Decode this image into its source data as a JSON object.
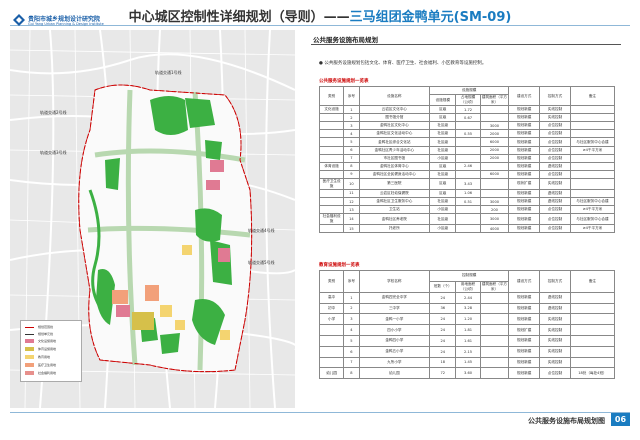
{
  "header": {
    "title_prefix": "中心城区控制性详细规划（导则）——",
    "title_accent": "三马组团金鸭单元(SM-09)"
  },
  "map": {
    "labels": {
      "rail1": "轨道交通1号线",
      "rail2": "轨道交通2号线",
      "rail3": "轨道交通3号线",
      "rail4": "轨道交通4号线",
      "rail5": "轨道交通5号线"
    },
    "legend": {
      "items": [
        {
          "label": "规划范围线",
          "color": "#cc0000"
        },
        {
          "label": "规划单元线",
          "color": "#333333"
        },
        {
          "label": "文化设施用地",
          "color": "#e07a93"
        },
        {
          "label": "体育设施用地",
          "color": "#d6c04a"
        },
        {
          "label": "教育用地",
          "color": "#f4d470"
        },
        {
          "label": "医疗卫生用地",
          "color": "#f2a07a"
        },
        {
          "label": "社会福利用地",
          "color": "#e7908c"
        }
      ]
    }
  },
  "right": {
    "section_title": "公共服务设施布局规划",
    "bullet": "● 公共服务设施规划包括文化、体育、医疗卫生、社会福利、小区教育等设施控制。",
    "table1_title": "公共服务设施规划一览表",
    "table1_headers": [
      "类别",
      "序号",
      "设施名称",
      "设施规模",
      "占地规模（公顷）",
      "建筑面积（平方米）",
      "建设方式",
      "控制方式",
      "备注"
    ],
    "table1_group_header": "设施规模",
    "table1_rows": [
      [
        "文化设施",
        "1",
        "云岩区文化中心",
        "区级",
        "1.72",
        "",
        "规划新建",
        "实线控制",
        ""
      ],
      [
        "",
        "2",
        "图书馆分馆",
        "区级",
        "0.67",
        "",
        "规划新建",
        "实线控制",
        ""
      ],
      [
        "",
        "3",
        "金鸭社区文化中心",
        "社区级",
        "",
        "3000",
        "规划新建",
        "点位控制",
        ""
      ],
      [
        "",
        "4",
        "金鸭社区文化活动中心",
        "社区级",
        "0.55",
        "2000",
        "规划新建",
        "点位控制",
        ""
      ],
      [
        "",
        "5",
        "金鸭社区综合文化站",
        "社区级",
        "",
        "6000",
        "规划新建",
        "点位控制",
        "与社区服务中心合建"
      ],
      [
        "",
        "6",
        "金鸭社区青少年活动中心",
        "社区级",
        "",
        "2000",
        "规划新建",
        "点位控制",
        "≥4千平方米"
      ],
      [
        "",
        "7",
        "市社区图书馆",
        "小区级",
        "",
        "2000",
        "规划新建",
        "点位控制",
        ""
      ],
      [
        "体育设施",
        "8",
        "金鸭社区体育中心",
        "区级",
        "2.46",
        "",
        "规划新建",
        "虚线控制",
        ""
      ],
      [
        "",
        "9",
        "金鸭社区全民健身活动中心",
        "社区级",
        "",
        "6000",
        "规划新建",
        "点位控制",
        ""
      ],
      [
        "医疗卫生设施",
        "10",
        "第三医院",
        "区级",
        "3.43",
        "",
        "现状扩建",
        "实线控制",
        ""
      ],
      [
        "",
        "11",
        "云岩区妇幼保健院",
        "区级",
        "1.06",
        "",
        "规划新建",
        "虚线控制",
        ""
      ],
      [
        "",
        "12",
        "金鸭社区卫生服务中心",
        "社区级",
        "0.51",
        "3000",
        "规划新建",
        "虚线控制",
        "与社区服务中心合建"
      ],
      [
        "",
        "13",
        "卫生站",
        "小区级",
        "",
        "200",
        "规划新建",
        "点位控制",
        "≥4千平方米"
      ],
      [
        "社会福利设施",
        "14",
        "金鸭社区养老院",
        "社区级",
        "",
        "3000",
        "规划新建",
        "点位控制",
        "与社区服务中心合建"
      ],
      [
        "",
        "15",
        "托老所",
        "小区级",
        "",
        "4000",
        "规划新建",
        "点位控制",
        "≥4千平方米"
      ]
    ],
    "table2_title": "教育设施规划一览表",
    "table2_headers": [
      "类别",
      "序号",
      "学校名称",
      "班数（个）",
      "用地面积（公顷）",
      "建筑面积（平方米）",
      "建设方式",
      "控制方式",
      "备注"
    ],
    "table2_group_header": "控制规模",
    "table2_rows": [
      [
        "高中",
        "1",
        "金鸭四完全中学",
        "24",
        "2.44",
        "",
        "规划新建",
        "虚线控制",
        ""
      ],
      [
        "初中",
        "2",
        "三中学",
        "36",
        "3.28",
        "",
        "规划新建",
        "虚线控制",
        ""
      ],
      [
        "小学",
        "3",
        "金鸭一小学",
        "24",
        "1.20",
        "",
        "规划新建",
        "实线控制",
        ""
      ],
      [
        "",
        "4",
        "四小小学",
        "24",
        "1.81",
        "",
        "规划扩建",
        "实线控制",
        ""
      ],
      [
        "",
        "5",
        "金鸭四小学",
        "24",
        "1.61",
        "",
        "规划新建",
        "实线控制",
        ""
      ],
      [
        "",
        "6",
        "金鸭五小学",
        "24",
        "2.15",
        "",
        "规划新建",
        "实线控制",
        ""
      ],
      [
        "",
        "7",
        "九所小学",
        "18",
        "1.45",
        "",
        "规划新建",
        "实线控制",
        ""
      ],
      [
        "幼儿园",
        "8",
        "幼儿园",
        "72",
        "3.60",
        "",
        "规划新建",
        "点位控制",
        "18处（每处4班）"
      ]
    ]
  },
  "footer": {
    "org": "贵阳市城乡规划设计研究院",
    "org_en": "Gui Yang Urban Planning & Design Institute",
    "map_title": "公共服务设施布局规划图",
    "page": "06"
  }
}
